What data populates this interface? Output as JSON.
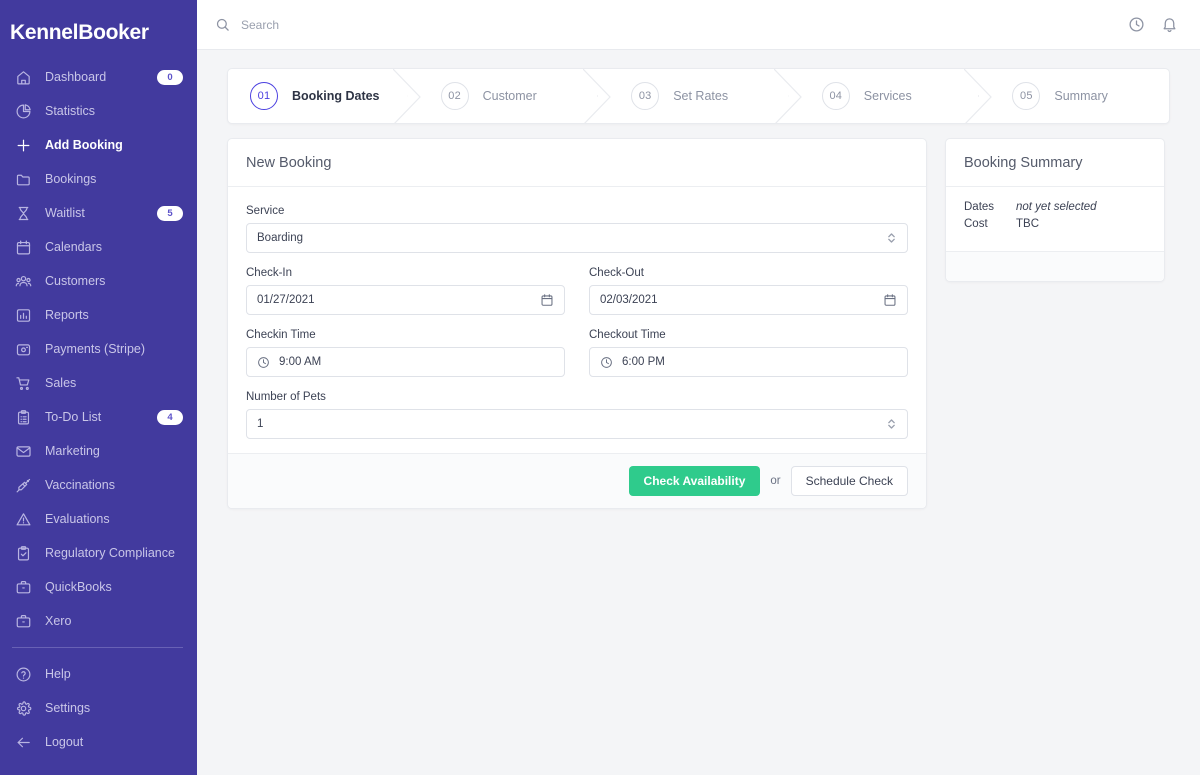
{
  "brand": {
    "name": "KennelBooker"
  },
  "topbar": {
    "search": {
      "placeholder": "Search",
      "value": ""
    },
    "icons": [
      {
        "name": "clock-icon",
        "label": "Recent activity"
      },
      {
        "name": "bell-icon",
        "label": "Notifications"
      }
    ]
  },
  "sidebar": {
    "items": [
      {
        "label": "Dashboard",
        "icon": "home-icon",
        "badge": "0",
        "active": false
      },
      {
        "label": "Statistics",
        "icon": "pie-chart-icon",
        "badge": null,
        "active": false
      },
      {
        "label": "Add Booking",
        "icon": "plus-icon",
        "badge": null,
        "active": true
      },
      {
        "label": "Bookings",
        "icon": "folder-icon",
        "badge": null,
        "active": false
      },
      {
        "label": "Waitlist",
        "icon": "hourglass-icon",
        "badge": "5",
        "active": false
      },
      {
        "label": "Calendars",
        "icon": "calendar-icon",
        "badge": null,
        "active": false
      },
      {
        "label": "Customers",
        "icon": "users-icon",
        "badge": null,
        "active": false
      },
      {
        "label": "Reports",
        "icon": "bar-chart-icon",
        "badge": null,
        "active": false
      },
      {
        "label": "Payments (Stripe)",
        "icon": "credit-card-icon",
        "badge": null,
        "active": false
      },
      {
        "label": "Sales",
        "icon": "shopping-cart-icon",
        "badge": null,
        "active": false
      },
      {
        "label": "To-Do List",
        "icon": "clipboard-list-icon",
        "badge": "4",
        "active": false
      },
      {
        "label": "Marketing",
        "icon": "envelope-icon",
        "badge": null,
        "active": false
      },
      {
        "label": "Vaccinations",
        "icon": "syringe-icon",
        "badge": null,
        "active": false
      },
      {
        "label": "Evaluations",
        "icon": "warning-triangle-icon",
        "badge": null,
        "active": false
      },
      {
        "label": "Regulatory Compliance",
        "icon": "clipboard-check-icon",
        "badge": null,
        "active": false
      },
      {
        "label": "QuickBooks",
        "icon": "briefcase-icon",
        "badge": null,
        "active": false
      },
      {
        "label": "Xero",
        "icon": "briefcase-icon",
        "badge": null,
        "active": false
      }
    ],
    "footer_items": [
      {
        "label": "Help",
        "icon": "question-circle-icon"
      },
      {
        "label": "Settings",
        "icon": "gear-icon"
      },
      {
        "label": "Logout",
        "icon": "arrow-left-icon"
      }
    ]
  },
  "stepper": {
    "steps": [
      {
        "num": "01",
        "label": "Booking Dates",
        "current": true
      },
      {
        "num": "02",
        "label": "Customer",
        "current": false
      },
      {
        "num": "03",
        "label": "Set Rates",
        "current": false
      },
      {
        "num": "04",
        "label": "Services",
        "current": false
      },
      {
        "num": "05",
        "label": "Summary",
        "current": false
      }
    ]
  },
  "form": {
    "title": "New Booking",
    "service": {
      "label": "Service",
      "value": "Boarding",
      "options": [
        "Boarding"
      ]
    },
    "check_in": {
      "label": "Check-In",
      "value": "01/27/2021",
      "icon": "calendar-icon"
    },
    "check_out": {
      "label": "Check-Out",
      "value": "02/03/2021",
      "icon": "calendar-icon"
    },
    "checkin_time": {
      "label": "Checkin Time",
      "value": "9:00 AM",
      "icon": "clock-icon"
    },
    "checkout_time": {
      "label": "Checkout Time",
      "value": "6:00 PM",
      "icon": "clock-icon"
    },
    "num_pets": {
      "label": "Number of Pets",
      "value": "1"
    },
    "primary_button": "Check Availability",
    "or_text": "or",
    "secondary_button": "Schedule Check"
  },
  "summary": {
    "title": "Booking Summary",
    "rows": [
      {
        "key": "Dates",
        "value": "not yet selected",
        "italic": true
      },
      {
        "key": "Cost",
        "value": "TBC",
        "italic": false
      }
    ]
  },
  "colors": {
    "sidebar": "#423a9e",
    "accent": "#4b40e0",
    "success": "#2fcb8c",
    "page_bg": "#f4f5f7"
  }
}
